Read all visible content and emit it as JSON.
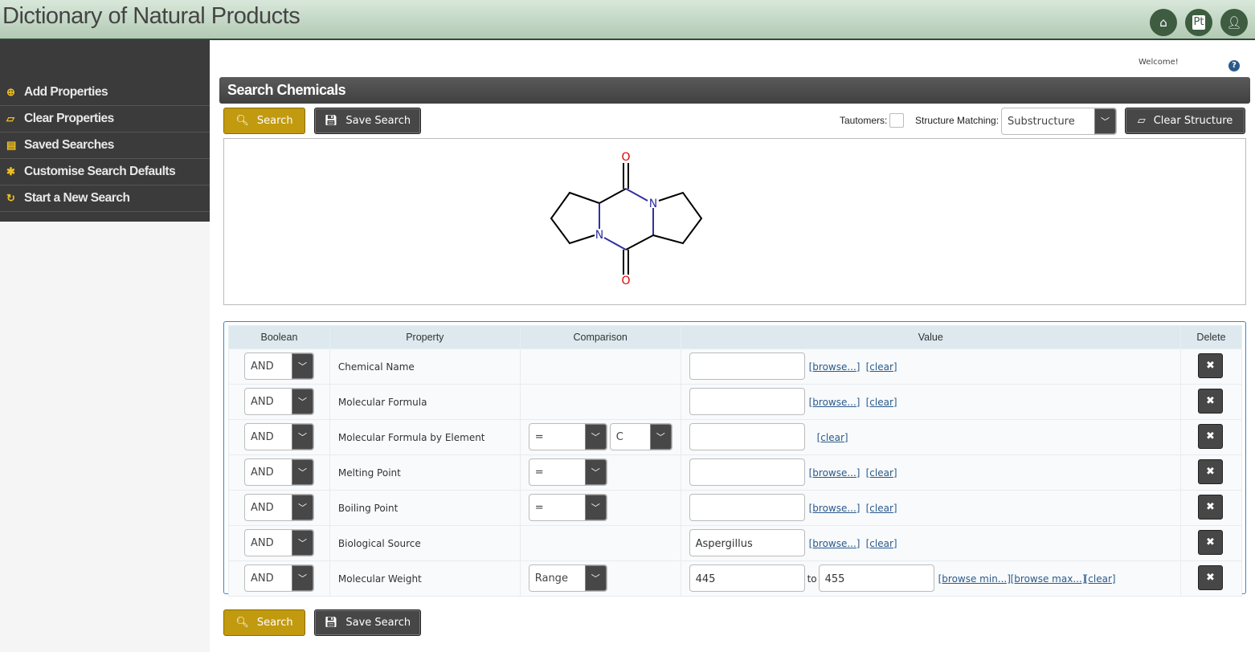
{
  "header": {
    "title": "Dictionary of Natural Products",
    "icons": [
      "home-icon",
      "periodic-table-icon",
      "user-icon"
    ],
    "pt_label": "Pt"
  },
  "sidebar": {
    "items": [
      {
        "label": "Add Properties",
        "icon": "plus-circle-icon",
        "glyph": "⊕"
      },
      {
        "label": "Clear Properties",
        "icon": "eraser-icon",
        "glyph": "▱"
      },
      {
        "label": "Saved Searches",
        "icon": "list-icon",
        "glyph": "▤"
      },
      {
        "label": "Customise Search Defaults",
        "icon": "asterisk-icon",
        "glyph": "✱"
      },
      {
        "label": "Start a New Search",
        "icon": "refresh-icon",
        "glyph": "↻"
      }
    ]
  },
  "welcome": "Welcome!",
  "help_glyph": "?",
  "panel": {
    "title": "Search Chemicals",
    "search_label": "Search",
    "save_label": "Save Search",
    "tautomers_label": "Tautomers:",
    "tautomers_checked": false,
    "matching_label": "Structure Matching:",
    "matching_value": "Substructure",
    "clear_structure_label": "Clear Structure"
  },
  "molecule": {
    "atoms": {
      "o_top": "O",
      "o_bottom": "O",
      "n_left": "N",
      "n_right": "N"
    },
    "colors": {
      "bond": "#000000",
      "nitrogen": "#3030a0",
      "oxygen": "#e00000"
    }
  },
  "table": {
    "headers": [
      "Boolean",
      "Property",
      "Comparison",
      "Value",
      "Delete"
    ],
    "rows": [
      {
        "boolean": "AND",
        "property": "Chemical Name",
        "value": "",
        "links": [
          "[browse...]",
          "[clear]"
        ]
      },
      {
        "boolean": "AND",
        "property": "Molecular Formula",
        "value": "",
        "links": [
          "[browse...]",
          "[clear]"
        ]
      },
      {
        "boolean": "AND",
        "property": "Molecular Formula by Element",
        "comparison": "=",
        "element": "C",
        "value": "",
        "links": [
          "[clear]"
        ]
      },
      {
        "boolean": "AND",
        "property": "Melting Point",
        "comparison": "=",
        "value": "",
        "links": [
          "[browse...]",
          "[clear]"
        ]
      },
      {
        "boolean": "AND",
        "property": "Boiling Point",
        "comparison": "=",
        "value": "",
        "links": [
          "[browse...]",
          "[clear]"
        ]
      },
      {
        "boolean": "AND",
        "property": "Biological Source",
        "value": "Aspergillus",
        "links": [
          "[browse...]",
          "[clear]"
        ]
      },
      {
        "boolean": "AND",
        "property": "Molecular Weight",
        "comparison": "Range",
        "value": "445",
        "to_label": "to",
        "value_max": "455",
        "links": [
          "[browse min...]",
          "[browse max...]",
          "[clear]"
        ]
      }
    ]
  },
  "colors": {
    "accent": "#c29a10",
    "header_green": "#3d5c40",
    "sidebar": "#3b3b3b",
    "table_border": "#3a86c8"
  }
}
